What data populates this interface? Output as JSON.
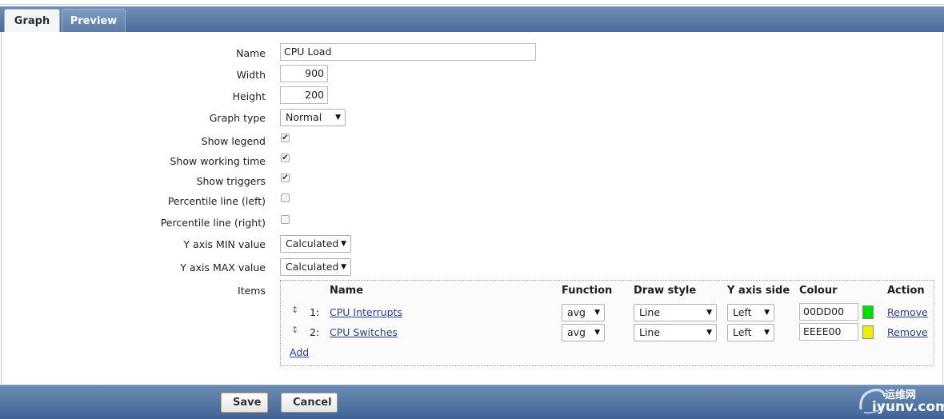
{
  "tabs": [
    {
      "label": "Graph",
      "active": true
    },
    {
      "label": "Preview",
      "active": false
    }
  ],
  "form": {
    "name_label": "Name",
    "name_value": "CPU Load",
    "width_label": "Width",
    "width_value": "900",
    "height_label": "Height",
    "height_value": "200",
    "graph_type_label": "Graph type",
    "graph_type_value": "Normal",
    "show_legend_label": "Show legend",
    "show_legend_checked": true,
    "show_working_time_label": "Show working time",
    "show_working_time_checked": true,
    "show_triggers_label": "Show triggers",
    "show_triggers_checked": true,
    "percentile_left_label": "Percentile line (left)",
    "percentile_left_checked": false,
    "percentile_right_label": "Percentile line (right)",
    "percentile_right_checked": false,
    "y_min_label": "Y axis MIN value",
    "y_min_value": "Calculated",
    "y_max_label": "Y axis MAX value",
    "y_max_value": "Calculated",
    "items_label": "Items"
  },
  "items": {
    "headers": {
      "name": "Name",
      "function": "Function",
      "draw_style": "Draw style",
      "y_axis_side": "Y axis side",
      "colour": "Colour",
      "action": "Action"
    },
    "rows": [
      {
        "index": "1:",
        "name": "CPU Interrupts",
        "function": "avg",
        "draw_style": "Line",
        "y_axis_side": "Left",
        "colour": "00DD00",
        "colour_hex": "#00DD00",
        "action": "Remove"
      },
      {
        "index": "2:",
        "name": "CPU Switches",
        "function": "avg",
        "draw_style": "Line",
        "y_axis_side": "Left",
        "colour": "EEEE00",
        "colour_hex": "#EEEE00",
        "action": "Remove"
      }
    ],
    "add_label": "Add"
  },
  "footer": {
    "save_label": "Save",
    "cancel_label": "Cancel"
  },
  "watermark": {
    "cn": "运维网",
    "domain": "iyunv.com"
  },
  "colors": {
    "header_bar": "#4a6d9a",
    "link": "#2a3f8f"
  }
}
